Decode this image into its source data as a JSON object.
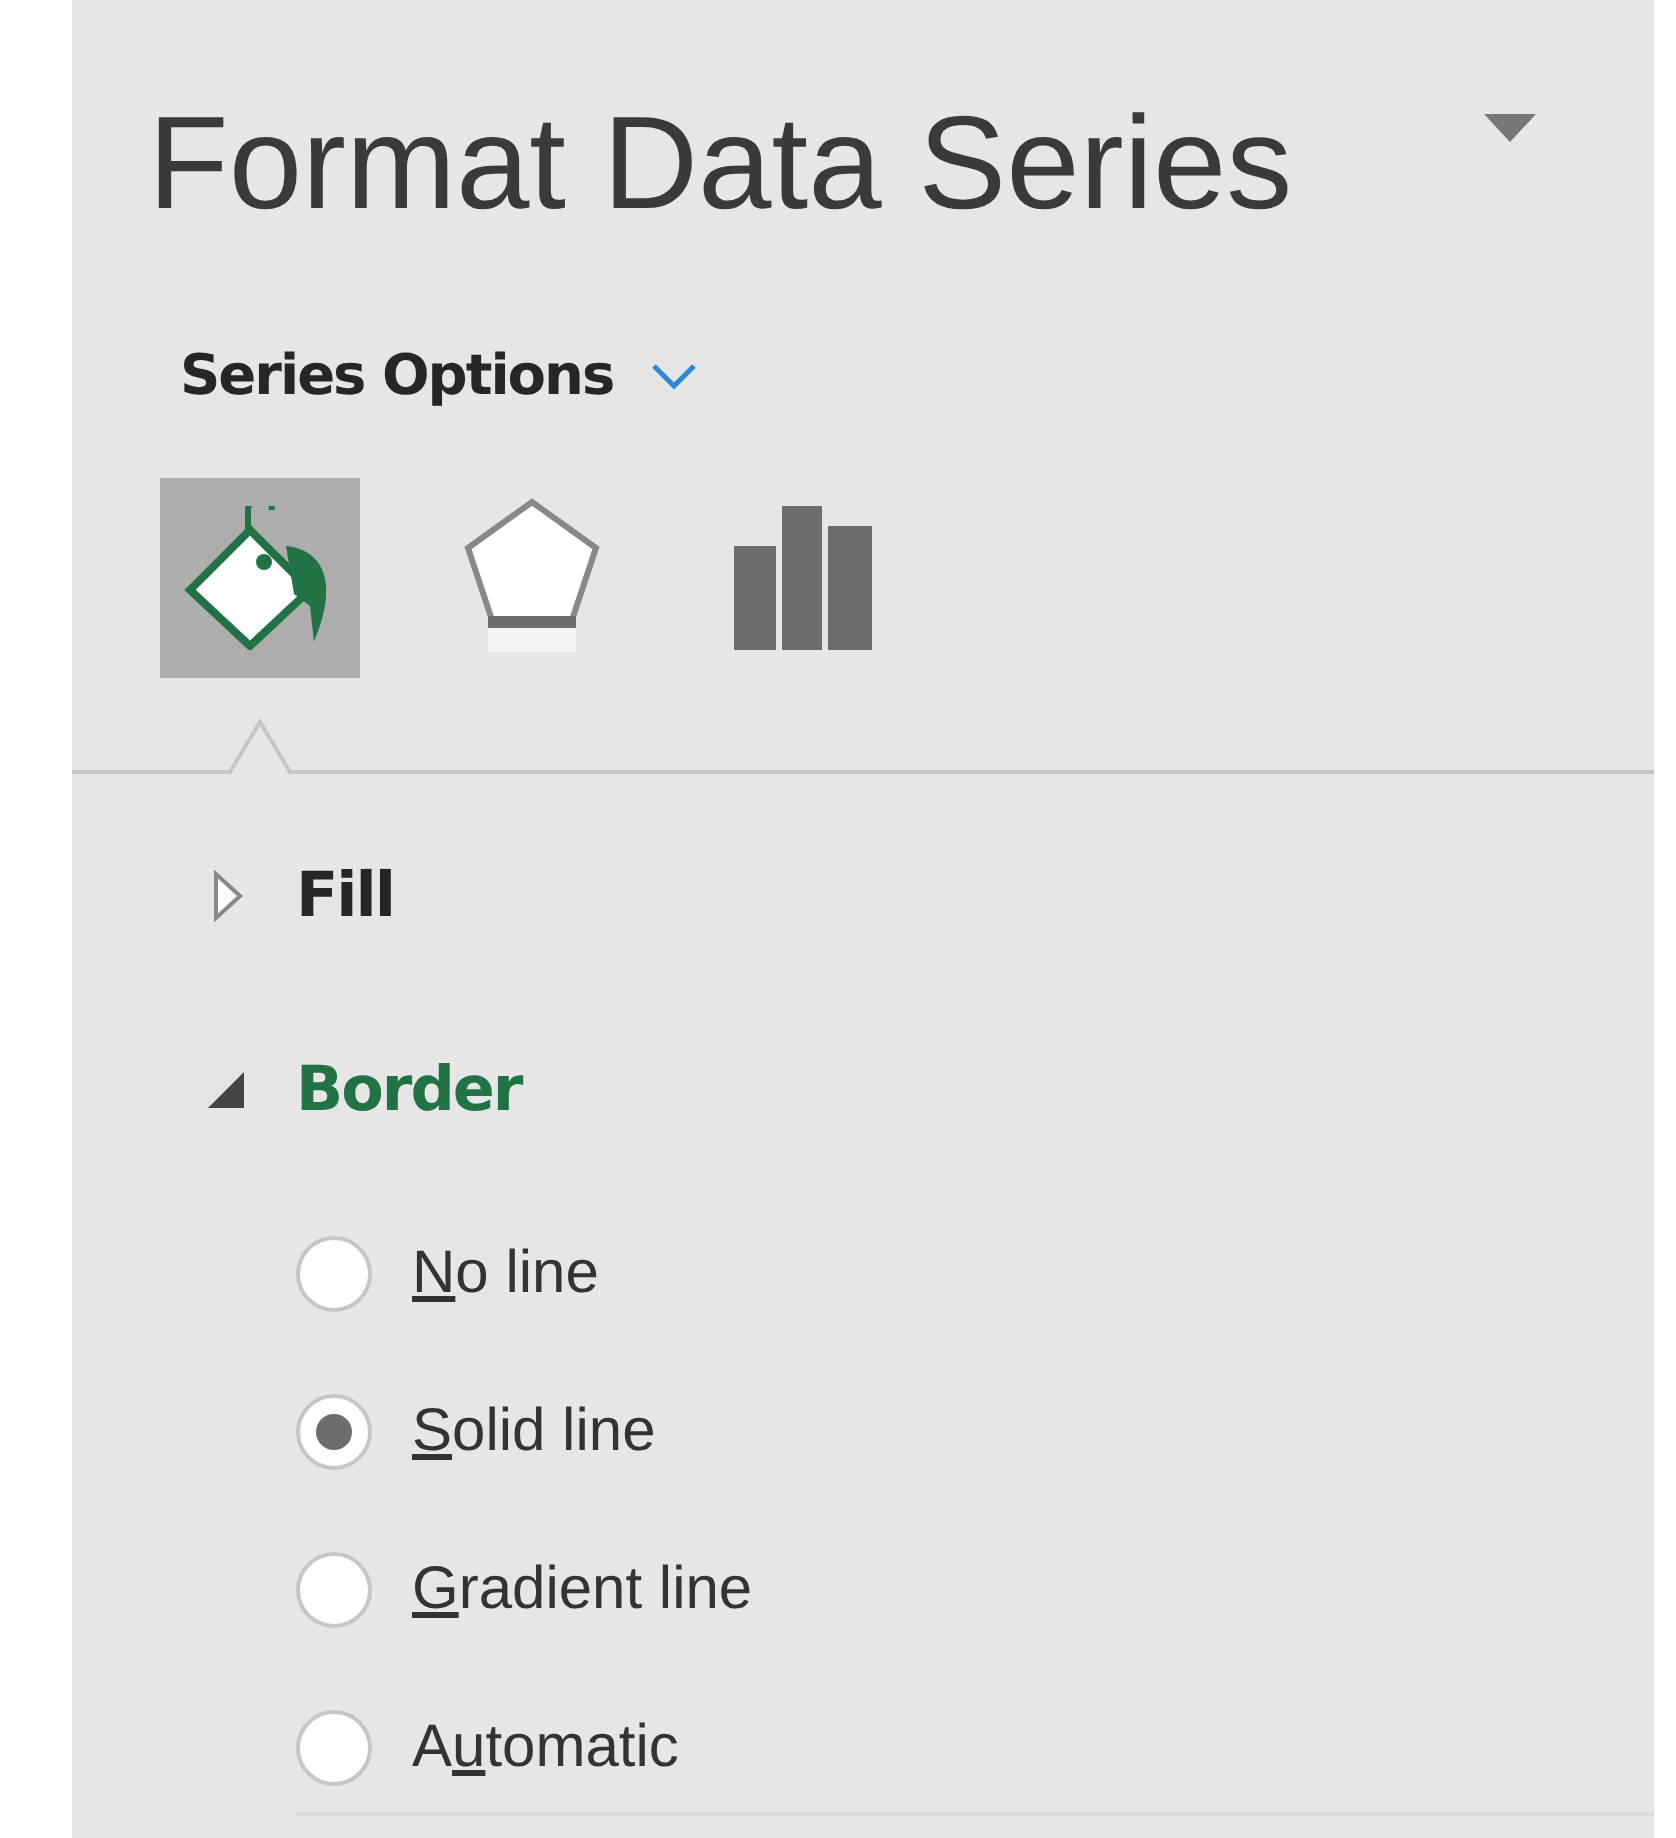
{
  "pane": {
    "title": "Format Data Series",
    "options_label": "Series Options"
  },
  "tabs": [
    {
      "kind": "fill",
      "selected": true
    },
    {
      "kind": "effects",
      "selected": false
    },
    {
      "kind": "series",
      "selected": false
    }
  ],
  "sections": [
    {
      "label": "Fill",
      "expanded": false
    },
    {
      "label": "Border",
      "expanded": true,
      "options": [
        {
          "key": "N",
          "rest": "o line",
          "selected": false
        },
        {
          "key": "S",
          "rest": "olid line",
          "selected": true
        },
        {
          "key": "G",
          "rest": "radient line",
          "selected": false
        },
        {
          "lead": "A",
          "key": "u",
          "rest": "tomatic",
          "selected": false
        }
      ]
    }
  ]
}
